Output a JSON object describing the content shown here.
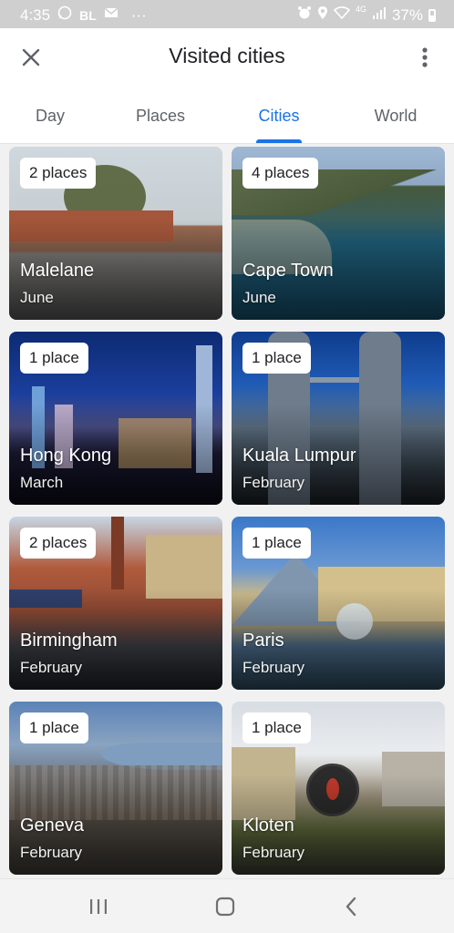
{
  "status_bar": {
    "time": "4:35",
    "carrier_badge": "BL",
    "more_dots": "···",
    "signal_label": "4G",
    "battery_percent": "37%"
  },
  "app_bar": {
    "title": "Visited cities"
  },
  "tabs": [
    {
      "label": "Day",
      "active": false
    },
    {
      "label": "Places",
      "active": false
    },
    {
      "label": "Cities",
      "active": true
    },
    {
      "label": "World",
      "active": false
    }
  ],
  "cities": [
    {
      "badge": "2 places",
      "name": "Malelane",
      "month": "June"
    },
    {
      "badge": "4 places",
      "name": "Cape Town",
      "month": "June"
    },
    {
      "badge": "1 place",
      "name": "Hong Kong",
      "month": "March"
    },
    {
      "badge": "1 place",
      "name": "Kuala Lumpur",
      "month": "February"
    },
    {
      "badge": "2 places",
      "name": "Birmingham",
      "month": "February"
    },
    {
      "badge": "1 place",
      "name": "Paris",
      "month": "February"
    },
    {
      "badge": "1 place",
      "name": "Geneva",
      "month": "February"
    },
    {
      "badge": "1 place",
      "name": "Kloten",
      "month": "February"
    }
  ],
  "colors": {
    "accent": "#1a73e8",
    "status_bar": "#cfcfcf",
    "tab_inactive": "#5f6368"
  },
  "icons": {
    "close": "close-icon",
    "more": "more-vert-icon",
    "recents": "recents-icon",
    "home": "home-icon",
    "back": "back-icon"
  }
}
